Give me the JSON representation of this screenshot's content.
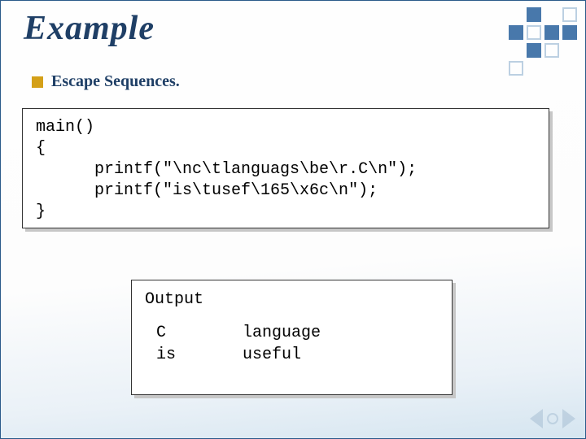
{
  "title": "Example",
  "subtitle": "Escape Sequences.",
  "code": {
    "l1": "main()",
    "l2": "{",
    "l3": "      printf(\"\\nc\\tlanguags\\be\\r.C\\n\");",
    "l4": "      printf(\"is\\tusef\\165\\x6c\\n\");",
    "l5": "}"
  },
  "output": {
    "label": "Output",
    "rows": [
      {
        "c1": "C",
        "c2": "language"
      },
      {
        "c1": "is",
        "c2": "useful"
      }
    ]
  }
}
